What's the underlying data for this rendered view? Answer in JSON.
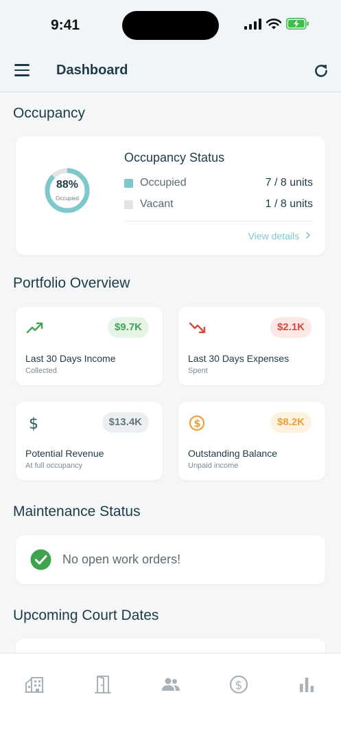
{
  "status_bar": {
    "time": "9:41"
  },
  "header": {
    "title": "Dashboard"
  },
  "occupancy": {
    "section_title": "Occupancy",
    "percent_label": "88%",
    "percent_value": 0.875,
    "ring_sublabel": "Occupied",
    "card_title": "Occupancy Status",
    "occupied_label": "Occupied",
    "occupied_value": "7 / 8 units",
    "vacant_label": "Vacant",
    "vacant_value": "1 / 8 units",
    "view_details": "View details",
    "colors": {
      "occupied": "#7ec8cc",
      "vacant": "#e3e3e3"
    }
  },
  "portfolio": {
    "section_title": "Portfolio Overview",
    "cards": [
      {
        "icon": "trending-up-icon",
        "badge": "$9.7K",
        "label": "Last 30 Days Income",
        "sub": "Collected",
        "badge_bg": "#e6f4e8",
        "badge_fg": "#43a357"
      },
      {
        "icon": "trending-down-icon",
        "badge": "$2.1K",
        "label": "Last 30 Days Expenses",
        "sub": "Spent",
        "badge_bg": "#fbe7e5",
        "badge_fg": "#d9473b"
      },
      {
        "icon": "dollar-sign-icon",
        "badge": "$13.4K",
        "label": "Potential Revenue",
        "sub": "At full occupancy",
        "badge_bg": "#eceff1",
        "badge_fg": "#66757d"
      },
      {
        "icon": "dollar-coin-icon",
        "badge": "$8.2K",
        "label": "Outstanding Balance",
        "sub": "Unpaid income",
        "badge_bg": "#fdf2e0",
        "badge_fg": "#e9a23b"
      }
    ]
  },
  "maintenance": {
    "section_title": "Maintenance Status",
    "message": "No open work orders!"
  },
  "court": {
    "section_title": "Upcoming Court Dates"
  },
  "bottom_nav": [
    {
      "icon": "buildings-icon"
    },
    {
      "icon": "door-icon"
    },
    {
      "icon": "people-icon"
    },
    {
      "icon": "dollar-coin-icon"
    },
    {
      "icon": "bar-chart-icon"
    }
  ]
}
